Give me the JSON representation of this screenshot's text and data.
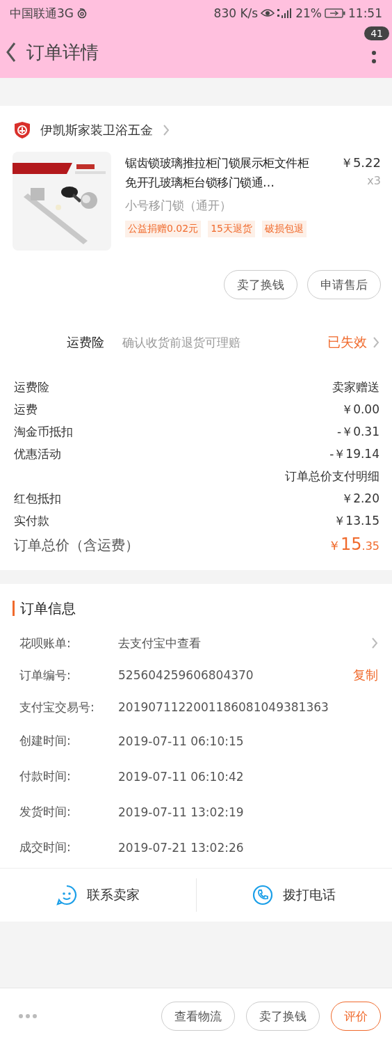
{
  "status_bar": {
    "carrier": "中国联通3G",
    "speed": "830 K/s",
    "battery": "21%",
    "time": "11:51"
  },
  "header": {
    "title": "订单详情",
    "badge": "41"
  },
  "shop": {
    "name": "伊凯斯家装卫浴五金"
  },
  "product": {
    "title": "锯齿锁玻璃推拉柜门锁展示柜文件柜免开孔玻璃柜台锁移门锁通…",
    "price": "￥5.22",
    "quantity": "x3",
    "variant": "小号移门锁（通开）",
    "tags": [
      "公益捐赠0.02元",
      "15天退货",
      "破损包退"
    ]
  },
  "item_buttons": [
    "卖了换钱",
    "申请售后"
  ],
  "insurance": {
    "label": "运费险",
    "description": "确认收货前退货可理赔",
    "status": "已失效"
  },
  "price_rows": [
    {
      "kind": "row",
      "label": "运费险",
      "value": "卖家赠送"
    },
    {
      "kind": "row",
      "label": "运费",
      "value": "￥0.00"
    },
    {
      "kind": "row",
      "label": "淘金币抵扣",
      "value": "-￥0.31"
    },
    {
      "kind": "row",
      "label": "优惠活动",
      "value": "-￥19.14"
    },
    {
      "kind": "note",
      "value": "订单总价支付明细"
    },
    {
      "kind": "row",
      "label": "红包抵扣",
      "value": "￥2.20"
    },
    {
      "kind": "row",
      "label": "实付款",
      "value": "￥13.15"
    }
  ],
  "total": {
    "label": "订单总价（含运费）",
    "currency": "￥",
    "integer": "15",
    "decimal": ".35"
  },
  "order_info": {
    "title": "订单信息",
    "rows": [
      {
        "kind": "link",
        "label": "花呗账单:",
        "value": "去支付宝中查看"
      },
      {
        "kind": "copy",
        "label": "订单编号:",
        "value": "525604259606804370",
        "action": "复制"
      },
      {
        "kind": "plain",
        "label": "支付宝交易号:",
        "value": "2019071122001186081049381363"
      },
      {
        "kind": "plain",
        "label": "创建时间:",
        "value": "2019-07-11 06:10:15"
      },
      {
        "kind": "plain",
        "label": "付款时间:",
        "value": "2019-07-11 06:10:42"
      },
      {
        "kind": "plain",
        "label": "发货时间:",
        "value": "2019-07-11 13:02:19"
      },
      {
        "kind": "plain",
        "label": "成交时间:",
        "value": "2019-07-21 13:02:26"
      }
    ]
  },
  "contact": [
    {
      "kind": "chat",
      "label": "联系卖家"
    },
    {
      "kind": "phone",
      "label": "拨打电话"
    }
  ],
  "bottom_buttons": [
    {
      "label": "查看物流",
      "highlighted": false
    },
    {
      "label": "卖了换钱",
      "highlighted": false
    },
    {
      "label": "评价",
      "highlighted": true
    }
  ]
}
